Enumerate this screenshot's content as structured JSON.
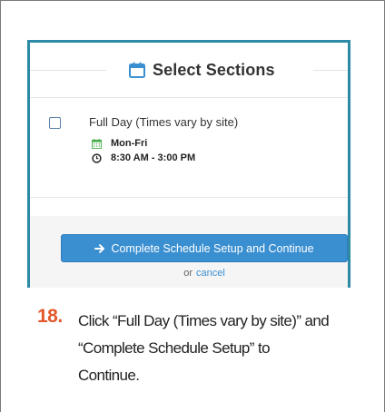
{
  "dialog": {
    "title": "Select Sections",
    "section": {
      "name": "Full Day (Times vary by site)",
      "checked": false,
      "days": "Mon-Fri",
      "times": "8:30 AM - 3:00 PM"
    },
    "continue_button": "Complete Schedule Setup and Continue",
    "or_text": "or",
    "cancel_link": "cancel"
  },
  "instruction": {
    "number": "18.",
    "text": "Click “Full Day (Times vary by site)” and “Complete Schedule Setup” to Continue."
  },
  "colors": {
    "frame_border": "#2c8aa5",
    "button": "#3a8fd1",
    "step_number": "#e2582a",
    "calendar_icon": "#4caf50"
  },
  "icons": {
    "title": "calendar-icon",
    "days": "calendar-icon",
    "times": "clock-icon",
    "button": "arrow-right-icon"
  }
}
